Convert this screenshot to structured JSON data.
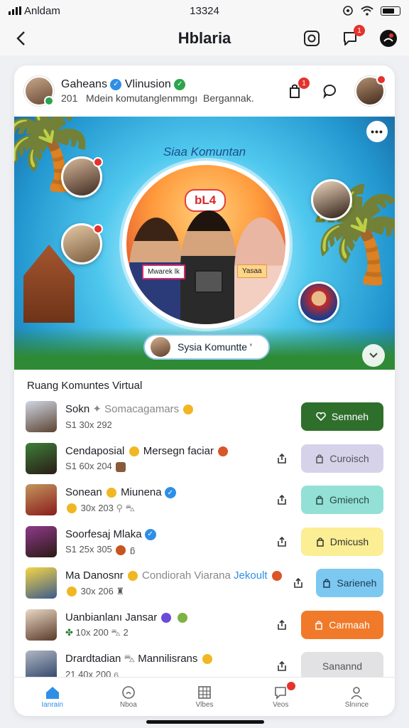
{
  "status": {
    "carrier": "Anldam",
    "time": "13324"
  },
  "header": {
    "title": "Hblaria",
    "notif_badge": "1"
  },
  "post": {
    "name": "Gaheans",
    "name2": "Vlinusion",
    "subtitle": "201   Mdein komutanglenmmgı  Bergannak.",
    "badge": "1"
  },
  "banner": {
    "title": "Siaa Komuntan",
    "circle_label": "bL4",
    "tag_left": "Mwarek lk",
    "tag_right": "Yasaa",
    "pill_text": "Sysia Komuntte '"
  },
  "list": {
    "title": "Ruang Komuntes Virtual",
    "rows": [
      {
        "name": "Sokn",
        "extra": "Somacagamars",
        "meta": "S1  30x  292",
        "action": "Semneh",
        "bg": "#2f6f2c",
        "fg": "#ffffff"
      },
      {
        "name": "Cendaposial",
        "extra": "Mersegn faciar",
        "meta": "S1  60x  204",
        "action": "Curoisch",
        "bg": "#d5d2ea",
        "fg": "#555"
      },
      {
        "name": "Sonean",
        "extra": "Miunena",
        "meta": "30x  203",
        "action": "Gmiench",
        "bg": "#93e0d6",
        "fg": "#2a4a45"
      },
      {
        "name": "Soorfesaj Mlaka",
        "extra": "",
        "meta": "S1  25x  305",
        "action": "Dmicush",
        "bg": "#fbee94",
        "fg": "#333"
      },
      {
        "name": "Ma Danosnr",
        "extra": "Condiorah Viarana",
        "extra2": "Jekoult",
        "meta": "30x  206",
        "action": "Sarieneh",
        "bg": "#7cc8f1",
        "fg": "#1e3a52"
      },
      {
        "name": "Uanbianlanı Jansar",
        "extra": "",
        "meta": "10x  200",
        "meta2": "2",
        "action": "Carmaah",
        "bg": "#f07a2a",
        "fg": "#ffffff"
      },
      {
        "name": "Drardtadian",
        "extra": "Mannilisrans",
        "meta": "21  40x  200",
        "action": "Sanannd",
        "bg": "#e2e2e4",
        "fg": "#555"
      }
    ]
  },
  "nav": [
    {
      "label": "Ianrain",
      "icon": "home-icon"
    },
    {
      "label": "Nboa",
      "icon": "clock-icon"
    },
    {
      "label": "Vlbes",
      "icon": "grid-icon"
    },
    {
      "label": "Veos",
      "icon": "chat-icon"
    },
    {
      "label": "Slnınce",
      "icon": "profile-icon"
    }
  ]
}
